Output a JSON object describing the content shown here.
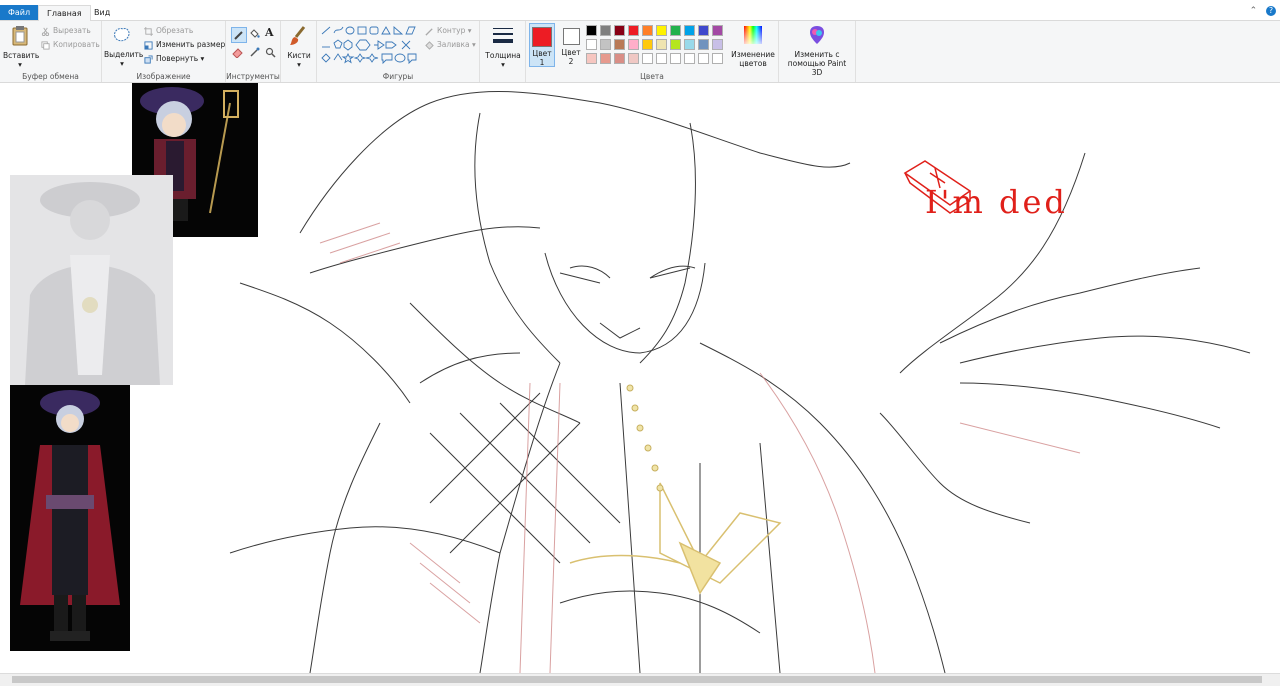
{
  "tabs": {
    "file": "Файл",
    "home": "Главная",
    "view": "Вид"
  },
  "ribbon": {
    "clipboard": {
      "paste": "Вставить",
      "cut": "Вырезать",
      "copy": "Копировать",
      "label": "Буфер обмена"
    },
    "image": {
      "select": "Выделить",
      "crop": "Обрезать",
      "resize": "Изменить размер",
      "rotate": "Повернуть",
      "label": "Изображение"
    },
    "tools": {
      "label": "Инструменты",
      "text_glyph": "A"
    },
    "brushes": {
      "label": "Кисти"
    },
    "shapes": {
      "outline": "Контур",
      "fill": "Заливка",
      "label": "Фигуры"
    },
    "size": {
      "label": "Толщина"
    },
    "colors": {
      "color1": "Цвет",
      "color1_num": "1",
      "color2": "Цвет",
      "color2_num": "2",
      "edit": "Изменение цветов",
      "label": "Цвета",
      "color1_value": "#ed1c24",
      "color2_value": "#ffffff",
      "palette_row1": [
        "#000000",
        "#7f7f7f",
        "#880015",
        "#ed1c24",
        "#ff7f27",
        "#fff200",
        "#22b14c",
        "#00a2e8",
        "#3f48cc",
        "#a349a4"
      ],
      "palette_row2": [
        "#ffffff",
        "#c3c3c3",
        "#b97a57",
        "#ffaec9",
        "#ffc90e",
        "#efe4b0",
        "#b5e61d",
        "#99d9ea",
        "#7092be",
        "#c8bfe7"
      ],
      "palette_row3": [
        "#f6c6c0",
        "#e69a8e",
        "#d98e86",
        "#f0c8c4",
        "#ffffff",
        "#ffffff",
        "#ffffff",
        "#ffffff",
        "#ffffff",
        "#ffffff"
      ]
    },
    "paint3d": {
      "label": "Изменить с помощью Paint 3D"
    }
  },
  "canvas": {
    "annotation": "I'm ded"
  }
}
